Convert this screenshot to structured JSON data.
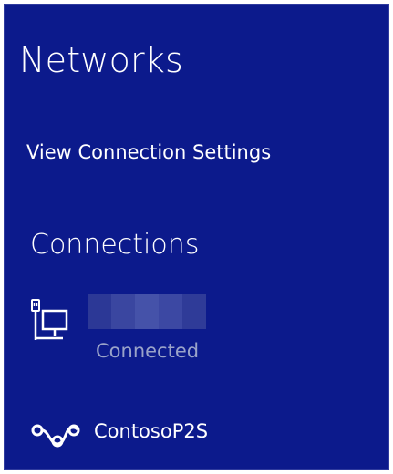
{
  "panel": {
    "title": "Networks",
    "settings_link": "View Connection Settings",
    "section_heading": "Connections"
  },
  "connections": [
    {
      "icon": "wired-network-icon",
      "name": "",
      "status": "Connected"
    },
    {
      "icon": "vpn-icon",
      "name": "ContosoP2S"
    }
  ],
  "colors": {
    "panel_background": "#0c1a8c",
    "text": "#ffffff",
    "muted_text": "#9aa3c9"
  }
}
